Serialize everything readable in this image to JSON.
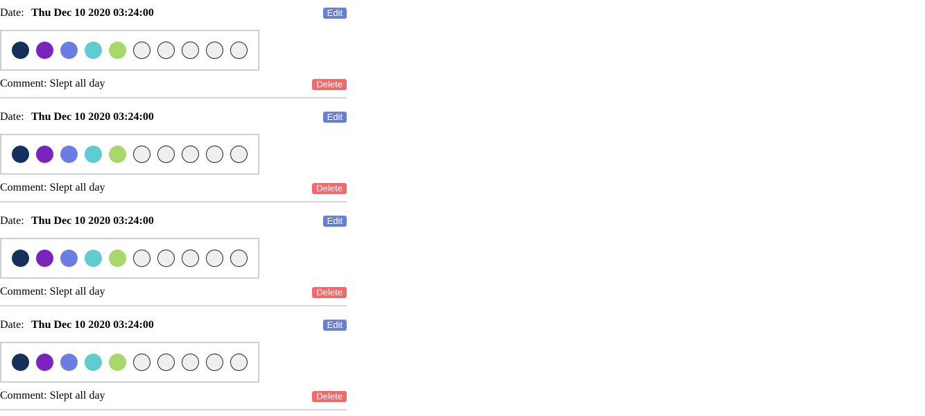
{
  "entries": [
    {
      "date_label": "Date:",
      "date_value": "Thu Dec 10 2020 03:24:00",
      "edit_label": "Edit",
      "comment_label": "Comment:",
      "comment_value": "Slept all day",
      "delete_label": "Delete",
      "rating": {
        "filled": 5,
        "total": 10
      }
    },
    {
      "date_label": "Date:",
      "date_value": "Thu Dec 10 2020 03:24:00",
      "edit_label": "Edit",
      "comment_label": "Comment:",
      "comment_value": "Slept all day",
      "delete_label": "Delete",
      "rating": {
        "filled": 5,
        "total": 10
      }
    },
    {
      "date_label": "Date:",
      "date_value": "Thu Dec 10 2020 03:24:00",
      "edit_label": "Edit",
      "comment_label": "Comment:",
      "comment_value": "Slept all day",
      "delete_label": "Delete",
      "rating": {
        "filled": 5,
        "total": 10
      }
    },
    {
      "date_label": "Date:",
      "date_value": "Thu Dec 10 2020 03:24:00",
      "edit_label": "Edit",
      "comment_label": "Comment:",
      "comment_value": "Slept all day",
      "delete_label": "Delete",
      "rating": {
        "filled": 5,
        "total": 10
      }
    }
  ],
  "rating_colors": [
    "#16305e",
    "#7b24bd",
    "#6b7de0",
    "#5fcdd0",
    "#a8d86a"
  ],
  "empty_dot_color": "#efefef",
  "edit_button_color": "#6680d6",
  "delete_button_color": "#f06a6a"
}
